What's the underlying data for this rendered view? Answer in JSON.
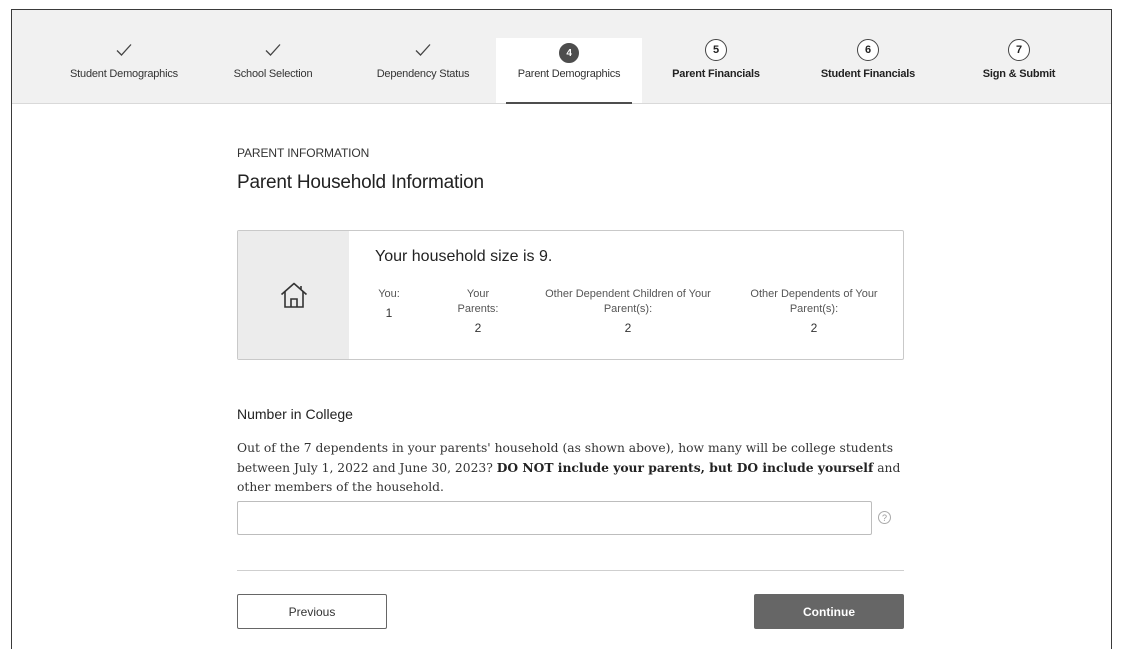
{
  "stepper": {
    "steps": [
      {
        "label": "Student Demographics",
        "status": "completed",
        "icon": "checkmark-icon"
      },
      {
        "label": "School Selection",
        "status": "completed",
        "icon": "checkmark-icon"
      },
      {
        "label": "Dependency Status",
        "status": "completed",
        "icon": "checkmark-icon"
      },
      {
        "label": "Parent Demographics",
        "status": "active",
        "number": "4"
      },
      {
        "label": "Parent Financials",
        "status": "upcoming",
        "number": "5"
      },
      {
        "label": "Student Financials",
        "status": "upcoming",
        "number": "6"
      },
      {
        "label": "Sign & Submit",
        "status": "upcoming",
        "number": "7"
      }
    ]
  },
  "main": {
    "eyebrow": "PARENT INFORMATION",
    "title": "Parent Household Information",
    "household": {
      "icon": "house-icon",
      "size_prefix": "Your household size is ",
      "size_value": "9.",
      "columns": [
        {
          "label": "You:",
          "value": "1"
        },
        {
          "label": "Your Parents:",
          "value": "2"
        },
        {
          "label": "Other Dependent Children of Your Parent(s):",
          "value": "2"
        },
        {
          "label": "Other Dependents of Your Parent(s):",
          "value": "2"
        }
      ]
    },
    "section_label": "Number in College",
    "question_part1": "Out of the 7 dependents in your parents' household (as shown above), how many will be college students between July 1, 2022 and June 30, 2023?",
    "question_bold": "DO NOT include your parents, but DO include yourself",
    "question_part2": "and other members of the household.",
    "answer_value": "",
    "help_icon": "question-circle-icon",
    "help_glyph": "?",
    "previous_label": "Previous",
    "continue_label": "Continue"
  },
  "colors": {
    "stepper_bg": "#f1f1f1",
    "active_step": "#4d4d4d",
    "continue_bg": "#666666",
    "icon_panel_bg": "#ececec"
  }
}
